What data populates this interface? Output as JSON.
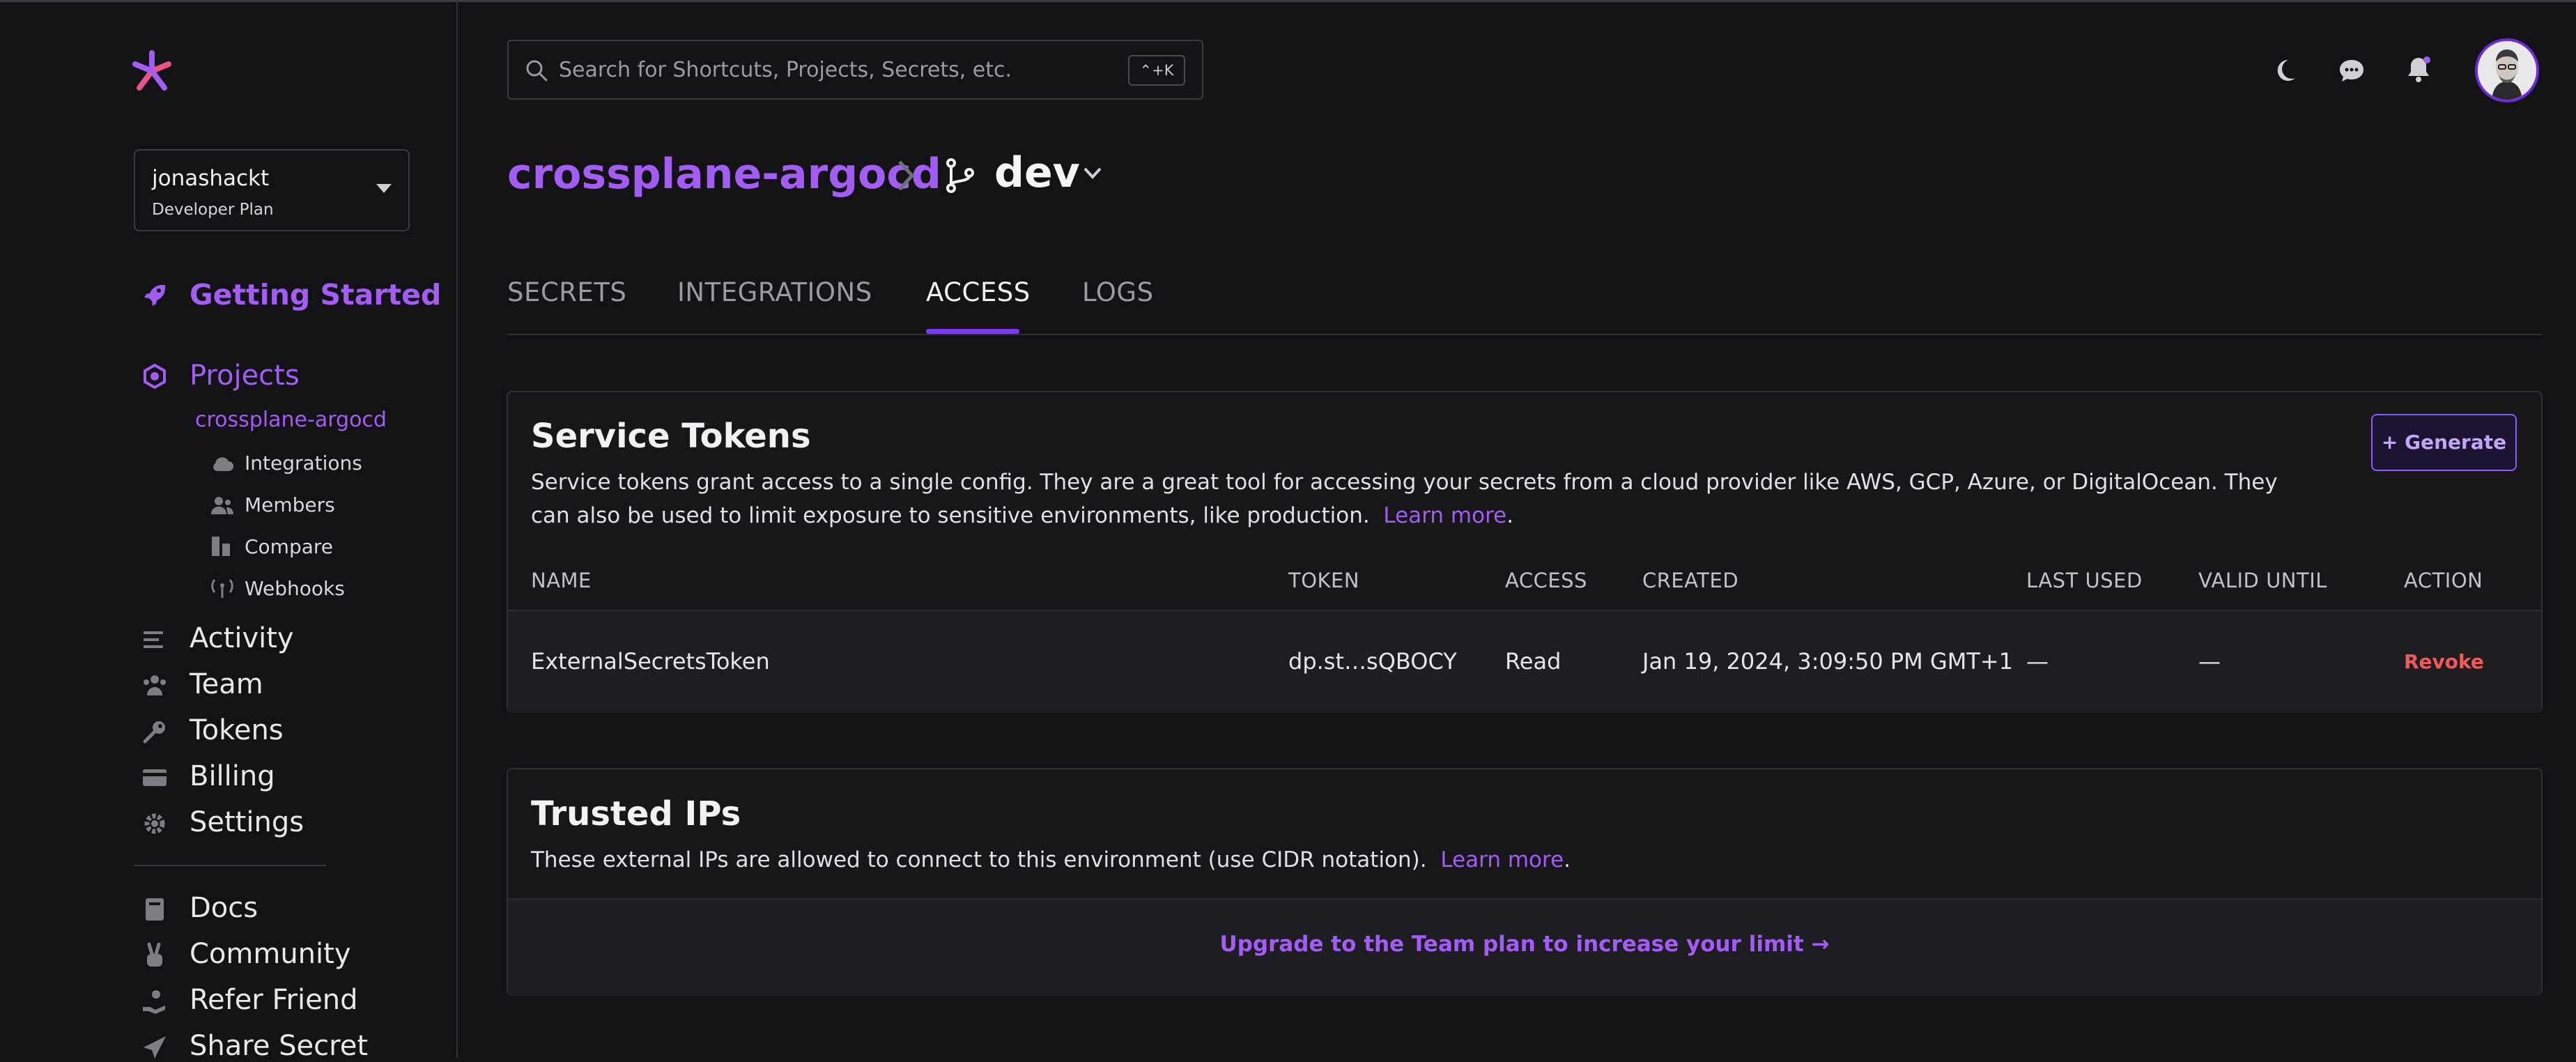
{
  "sidebar": {
    "org": {
      "name": "jonashackt",
      "plan": "Developer Plan"
    },
    "getting_started": "Getting Started",
    "projects": "Projects",
    "current_project": "crossplane-argocd",
    "project_sub": [
      "Integrations",
      "Members",
      "Compare",
      "Webhooks"
    ],
    "nav": [
      "Activity",
      "Team",
      "Tokens",
      "Billing",
      "Settings"
    ],
    "resources": [
      "Docs",
      "Community",
      "Refer Friend",
      "Share Secret"
    ]
  },
  "header": {
    "search_placeholder": "Search for Shortcuts, Projects, Secrets, etc.",
    "search_shortcut": "⌃+K",
    "icons": [
      "moon-icon",
      "chat-icon",
      "bell-icon"
    ]
  },
  "breadcrumb": {
    "project": "crossplane-argocd",
    "environment": "dev"
  },
  "tabs": [
    "SECRETS",
    "INTEGRATIONS",
    "ACCESS",
    "LOGS"
  ],
  "active_tab": "ACCESS",
  "service_tokens": {
    "title": "Service Tokens",
    "description": "Service tokens grant access to a single config. They are a great tool for accessing your secrets from a cloud provider like AWS, GCP, Azure, or DigitalOcean. They can also be used to limit exposure to sensitive environments, like production.",
    "learn_more": "Learn more",
    "period": ".",
    "generate_label": "Generate",
    "columns": [
      "NAME",
      "TOKEN",
      "ACCESS",
      "CREATED",
      "LAST USED",
      "VALID UNTIL",
      "ACTION"
    ],
    "rows": [
      {
        "name": "ExternalSecretsToken",
        "token": "dp.st…sQBOCY",
        "access": "Read",
        "created": "Jan 19, 2024, 3:09:50 PM GMT+1",
        "last_used": "—",
        "valid_until": "—",
        "action": "Revoke"
      }
    ]
  },
  "trusted_ips": {
    "title": "Trusted IPs",
    "description": "These external IPs are allowed to connect to this environment (use CIDR notation).",
    "learn_more": "Learn more",
    "period": ".",
    "upgrade_text": "Upgrade to the Team plan to increase your limit →"
  },
  "colors": {
    "accent": "#a35cf5",
    "background": "#131316",
    "danger": "#ef5a5a"
  }
}
